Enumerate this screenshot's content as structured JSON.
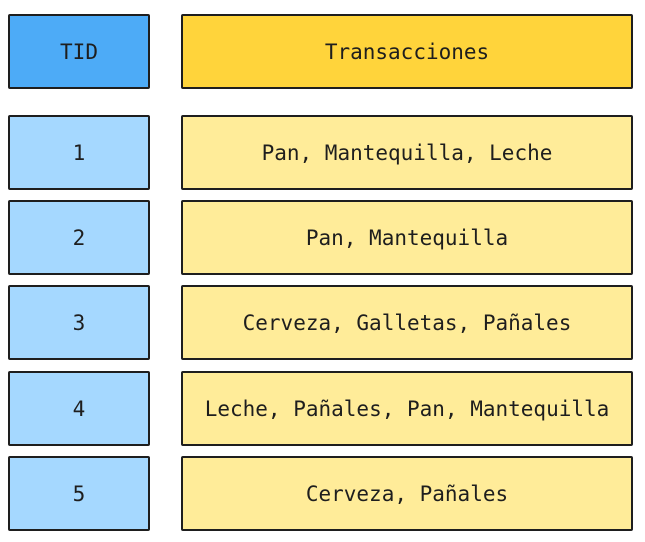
{
  "header": {
    "tid": "TID",
    "transactions": "Transacciones"
  },
  "rows": [
    {
      "tid": "1",
      "items": "Pan, Mantequilla, Leche"
    },
    {
      "tid": "2",
      "items": "Pan, Mantequilla"
    },
    {
      "tid": "3",
      "items": "Cerveza, Galletas, Pañales"
    },
    {
      "tid": "4",
      "items": "Leche, Pañales, Pan, Mantequilla"
    },
    {
      "tid": "5",
      "items": "Cerveza, Pañales"
    }
  ],
  "colors": {
    "header_tid": "#4dabf7",
    "header_transactions": "#ffd43b",
    "cell_tid": "#a5d8ff",
    "cell_transactions": "#ffec99",
    "stroke": "#1e1e1e"
  }
}
